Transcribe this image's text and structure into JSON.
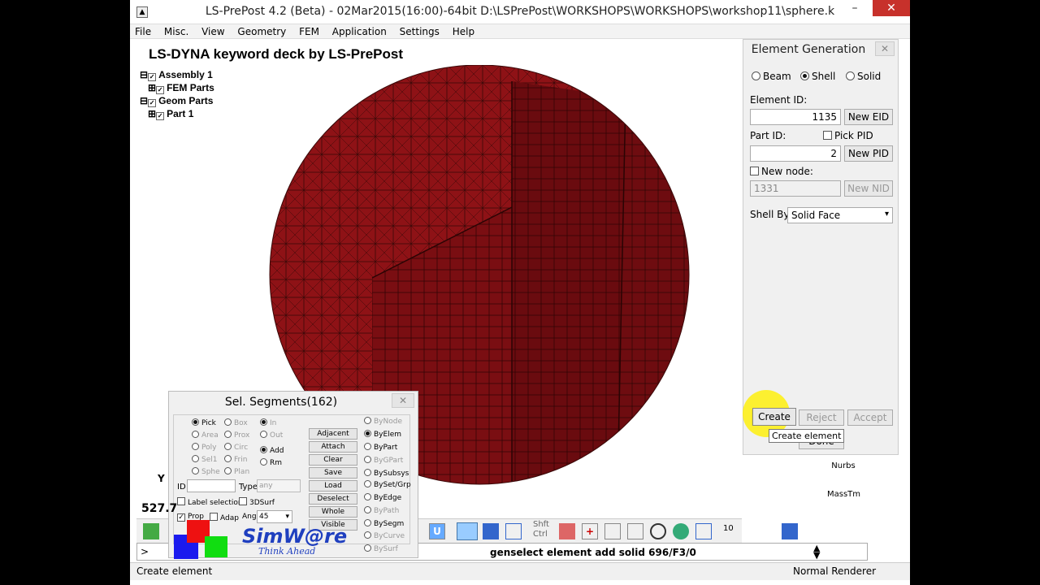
{
  "window": {
    "title": "LS-PrePost 4.2 (Beta) - 02Mar2015(16:00)-64bit D:\\LSPrePost\\WORKSHOPS\\WORKSHOPS\\workshop11\\sphere.k"
  },
  "menu": [
    "File",
    "Misc.",
    "View",
    "Geometry",
    "FEM",
    "Application",
    "Settings",
    "Help"
  ],
  "viewport": {
    "deck_title": "LS-DYNA keyword deck by LS-PrePost",
    "tree": [
      {
        "label": "Assembly 1"
      },
      {
        "label": "FEM Parts"
      },
      {
        "label": "Geom Parts"
      },
      {
        "label": "Part 1"
      }
    ],
    "axis_label": "Y",
    "coord_readout": "527.7"
  },
  "element_generation": {
    "title": "Element Generation",
    "types": [
      {
        "label": "Beam",
        "selected": false
      },
      {
        "label": "Shell",
        "selected": true
      },
      {
        "label": "Solid",
        "selected": false
      }
    ],
    "element_id_label": "Element ID:",
    "element_id_value": "1135",
    "new_eid_label": "New EID",
    "part_id_label": "Part ID:",
    "pick_pid_label": "Pick PID",
    "part_id_value": "2",
    "new_pid_label": "New PID",
    "new_node_label": "New node:",
    "node_value": "1331",
    "new_nid_label": "New NID",
    "shell_by_label": "Shell By:",
    "shell_by_value": "Solid Face",
    "create_label": "Create",
    "reject_label": "Reject",
    "accept_label": "Accept",
    "done_label": "Done",
    "tooltip": "Create element"
  },
  "sel_segments": {
    "title": "Sel. Segments(162)",
    "col1": [
      "Pick",
      "Area",
      "Poly",
      "Sel1",
      "Sphe"
    ],
    "col2": [
      "Box",
      "Prox",
      "Circ",
      "Frin",
      "Plan"
    ],
    "col3": [
      "In",
      "Out",
      "Add",
      "Rm"
    ],
    "buttons": [
      "Adjacent",
      "Attach",
      "Clear",
      "Save",
      "Load",
      "Deselect",
      "Whole",
      "Visible"
    ],
    "by_options": [
      "ByNode",
      "ByElem",
      "ByPart",
      "ByGPart",
      "BySubsys",
      "BySet/Grp",
      "ByEdge",
      "ByPath",
      "BySegm",
      "ByCurve",
      "BySurf"
    ],
    "id_label": "ID",
    "type_label": "Type",
    "type_value": "any",
    "label_selection": "Label selection",
    "surf3d": "3DSurf",
    "prop_label": "Prop",
    "adap_label": "Adap",
    "ang_label": "Ang",
    "ang_value": "45"
  },
  "logo": {
    "main": "SimW@re",
    "tagline": "Think Ahead"
  },
  "side_icons": [
    "Nurbs",
    "MassTm"
  ],
  "toolbar": {
    "shft_label": "Shft",
    "ctrl_label": "Ctrl",
    "count": "10"
  },
  "cmdline": {
    "prompt": ">",
    "text": "genselect element add solid 696/F3/0"
  },
  "status": {
    "left": "Create element",
    "right": "Normal Renderer"
  }
}
